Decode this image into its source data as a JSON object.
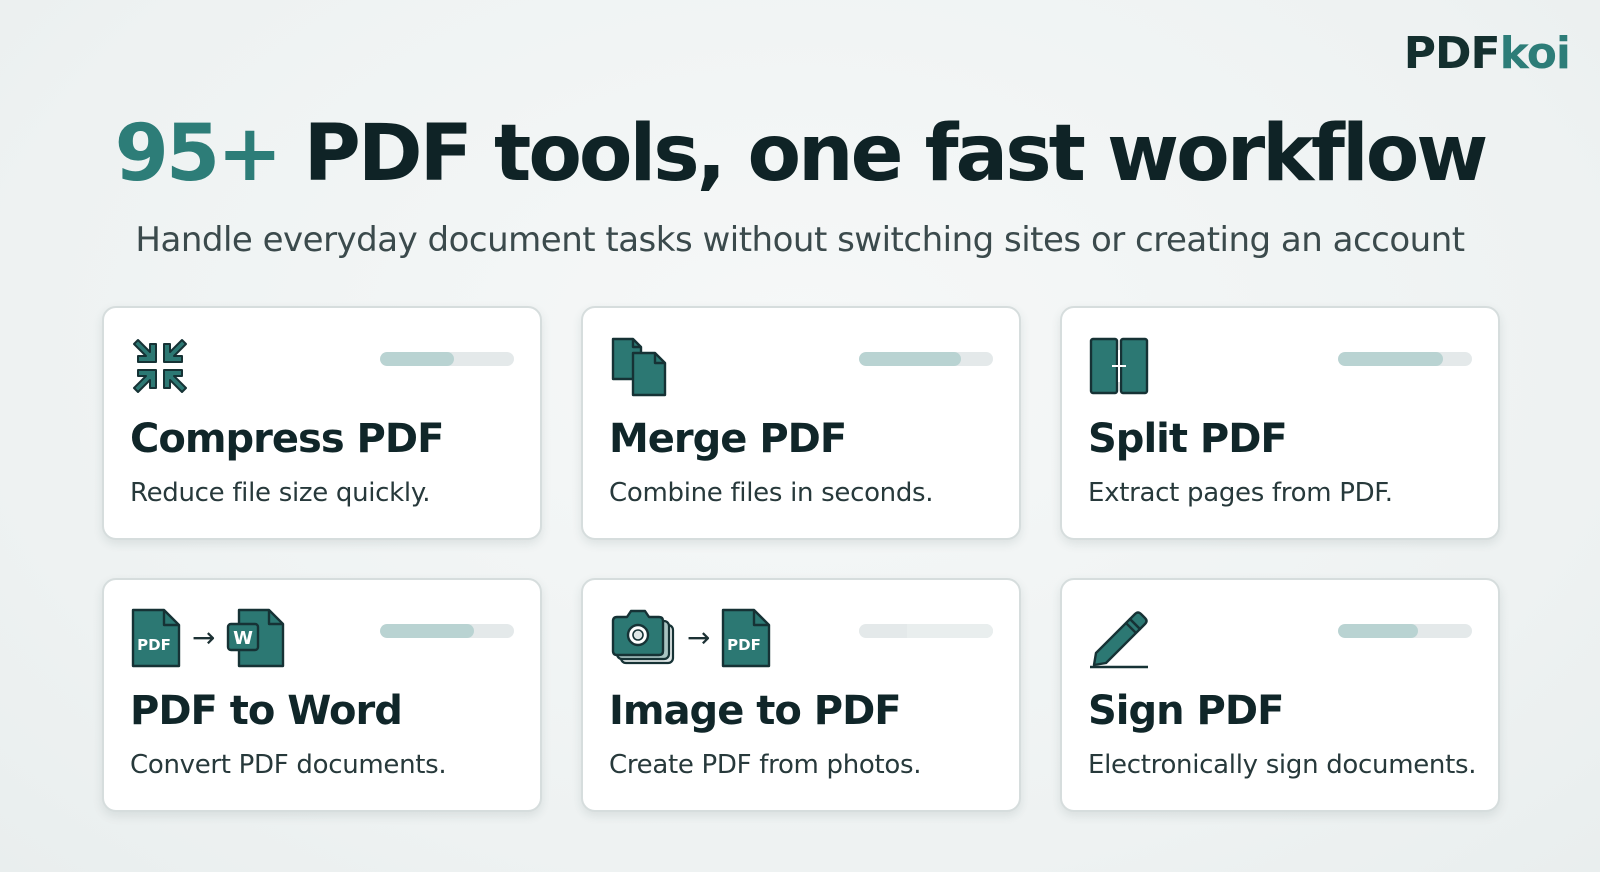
{
  "brand": {
    "name_part1": "PDF",
    "name_part2": "koi"
  },
  "hero": {
    "headline_accent": "95+",
    "headline_rest": " PDF tools, one fast workflow",
    "subhead": "Handle everyday document tasks without switching sites or creating an account"
  },
  "tools": [
    {
      "id": "compress",
      "title": "Compress PDF",
      "description": "Reduce file size quickly.",
      "icon": "compress-arrows-icon",
      "bar_fill": {
        "start": 0.0,
        "end": 0.55
      }
    },
    {
      "id": "merge",
      "title": "Merge PDF",
      "description": "Combine files in seconds.",
      "icon": "merge-documents-icon",
      "bar_fill": {
        "start": 0.0,
        "end": 0.76
      }
    },
    {
      "id": "split",
      "title": "Split PDF",
      "description": "Extract pages from PDF.",
      "icon": "split-document-icon",
      "bar_fill": {
        "start": 0.0,
        "end": 0.78
      }
    },
    {
      "id": "pdf-to-word",
      "title": "PDF to Word",
      "description": "Convert PDF documents.",
      "icon": "pdf-to-word-icon",
      "icon_labels": {
        "from": "PDF",
        "to": "W"
      },
      "bar_fill": {
        "start": 0.0,
        "end": 0.7
      }
    },
    {
      "id": "image-to-pdf",
      "title": "Image to PDF",
      "description": "Create PDF from photos.",
      "icon": "image-to-pdf-icon",
      "icon_labels": {
        "to": "PDF"
      },
      "bar_fill": {
        "start": 0.36,
        "end": 1.0
      }
    },
    {
      "id": "sign",
      "title": "Sign PDF",
      "description": "Electronically sign documents.",
      "icon": "pen-sign-icon",
      "bar_fill": {
        "start": 0.0,
        "end": 0.6
      }
    }
  ],
  "colors": {
    "accent": "#2d7d78",
    "icon_fill": "#2c7873",
    "icon_stroke": "#163235",
    "ink": "#0f2326",
    "bar_track": "#e4e9ea",
    "bar_fill": "#b9d3d2",
    "bar_fill_faint": "#e9eeee"
  }
}
